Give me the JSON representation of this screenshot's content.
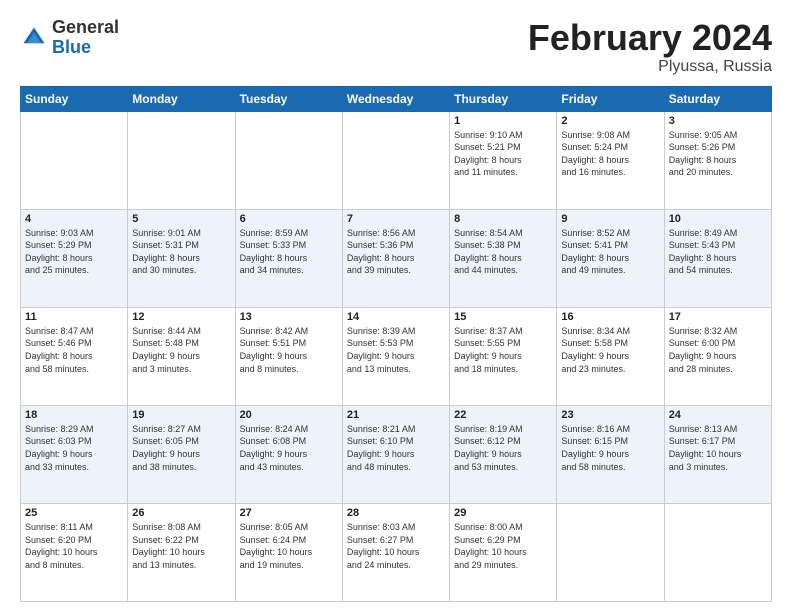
{
  "header": {
    "logo_general": "General",
    "logo_blue": "Blue",
    "title": "February 2024",
    "location": "Plyussa, Russia"
  },
  "weekdays": [
    "Sunday",
    "Monday",
    "Tuesday",
    "Wednesday",
    "Thursday",
    "Friday",
    "Saturday"
  ],
  "weeks": [
    [
      {
        "day": "",
        "info": ""
      },
      {
        "day": "",
        "info": ""
      },
      {
        "day": "",
        "info": ""
      },
      {
        "day": "",
        "info": ""
      },
      {
        "day": "1",
        "info": "Sunrise: 9:10 AM\nSunset: 5:21 PM\nDaylight: 8 hours\nand 11 minutes."
      },
      {
        "day": "2",
        "info": "Sunrise: 9:08 AM\nSunset: 5:24 PM\nDaylight: 8 hours\nand 16 minutes."
      },
      {
        "day": "3",
        "info": "Sunrise: 9:05 AM\nSunset: 5:26 PM\nDaylight: 8 hours\nand 20 minutes."
      }
    ],
    [
      {
        "day": "4",
        "info": "Sunrise: 9:03 AM\nSunset: 5:29 PM\nDaylight: 8 hours\nand 25 minutes."
      },
      {
        "day": "5",
        "info": "Sunrise: 9:01 AM\nSunset: 5:31 PM\nDaylight: 8 hours\nand 30 minutes."
      },
      {
        "day": "6",
        "info": "Sunrise: 8:59 AM\nSunset: 5:33 PM\nDaylight: 8 hours\nand 34 minutes."
      },
      {
        "day": "7",
        "info": "Sunrise: 8:56 AM\nSunset: 5:36 PM\nDaylight: 8 hours\nand 39 minutes."
      },
      {
        "day": "8",
        "info": "Sunrise: 8:54 AM\nSunset: 5:38 PM\nDaylight: 8 hours\nand 44 minutes."
      },
      {
        "day": "9",
        "info": "Sunrise: 8:52 AM\nSunset: 5:41 PM\nDaylight: 8 hours\nand 49 minutes."
      },
      {
        "day": "10",
        "info": "Sunrise: 8:49 AM\nSunset: 5:43 PM\nDaylight: 8 hours\nand 54 minutes."
      }
    ],
    [
      {
        "day": "11",
        "info": "Sunrise: 8:47 AM\nSunset: 5:46 PM\nDaylight: 8 hours\nand 58 minutes."
      },
      {
        "day": "12",
        "info": "Sunrise: 8:44 AM\nSunset: 5:48 PM\nDaylight: 9 hours\nand 3 minutes."
      },
      {
        "day": "13",
        "info": "Sunrise: 8:42 AM\nSunset: 5:51 PM\nDaylight: 9 hours\nand 8 minutes."
      },
      {
        "day": "14",
        "info": "Sunrise: 8:39 AM\nSunset: 5:53 PM\nDaylight: 9 hours\nand 13 minutes."
      },
      {
        "day": "15",
        "info": "Sunrise: 8:37 AM\nSunset: 5:55 PM\nDaylight: 9 hours\nand 18 minutes."
      },
      {
        "day": "16",
        "info": "Sunrise: 8:34 AM\nSunset: 5:58 PM\nDaylight: 9 hours\nand 23 minutes."
      },
      {
        "day": "17",
        "info": "Sunrise: 8:32 AM\nSunset: 6:00 PM\nDaylight: 9 hours\nand 28 minutes."
      }
    ],
    [
      {
        "day": "18",
        "info": "Sunrise: 8:29 AM\nSunset: 6:03 PM\nDaylight: 9 hours\nand 33 minutes."
      },
      {
        "day": "19",
        "info": "Sunrise: 8:27 AM\nSunset: 6:05 PM\nDaylight: 9 hours\nand 38 minutes."
      },
      {
        "day": "20",
        "info": "Sunrise: 8:24 AM\nSunset: 6:08 PM\nDaylight: 9 hours\nand 43 minutes."
      },
      {
        "day": "21",
        "info": "Sunrise: 8:21 AM\nSunset: 6:10 PM\nDaylight: 9 hours\nand 48 minutes."
      },
      {
        "day": "22",
        "info": "Sunrise: 8:19 AM\nSunset: 6:12 PM\nDaylight: 9 hours\nand 53 minutes."
      },
      {
        "day": "23",
        "info": "Sunrise: 8:16 AM\nSunset: 6:15 PM\nDaylight: 9 hours\nand 58 minutes."
      },
      {
        "day": "24",
        "info": "Sunrise: 8:13 AM\nSunset: 6:17 PM\nDaylight: 10 hours\nand 3 minutes."
      }
    ],
    [
      {
        "day": "25",
        "info": "Sunrise: 8:11 AM\nSunset: 6:20 PM\nDaylight: 10 hours\nand 8 minutes."
      },
      {
        "day": "26",
        "info": "Sunrise: 8:08 AM\nSunset: 6:22 PM\nDaylight: 10 hours\nand 13 minutes."
      },
      {
        "day": "27",
        "info": "Sunrise: 8:05 AM\nSunset: 6:24 PM\nDaylight: 10 hours\nand 19 minutes."
      },
      {
        "day": "28",
        "info": "Sunrise: 8:03 AM\nSunset: 6:27 PM\nDaylight: 10 hours\nand 24 minutes."
      },
      {
        "day": "29",
        "info": "Sunrise: 8:00 AM\nSunset: 6:29 PM\nDaylight: 10 hours\nand 29 minutes."
      },
      {
        "day": "",
        "info": ""
      },
      {
        "day": "",
        "info": ""
      }
    ]
  ]
}
